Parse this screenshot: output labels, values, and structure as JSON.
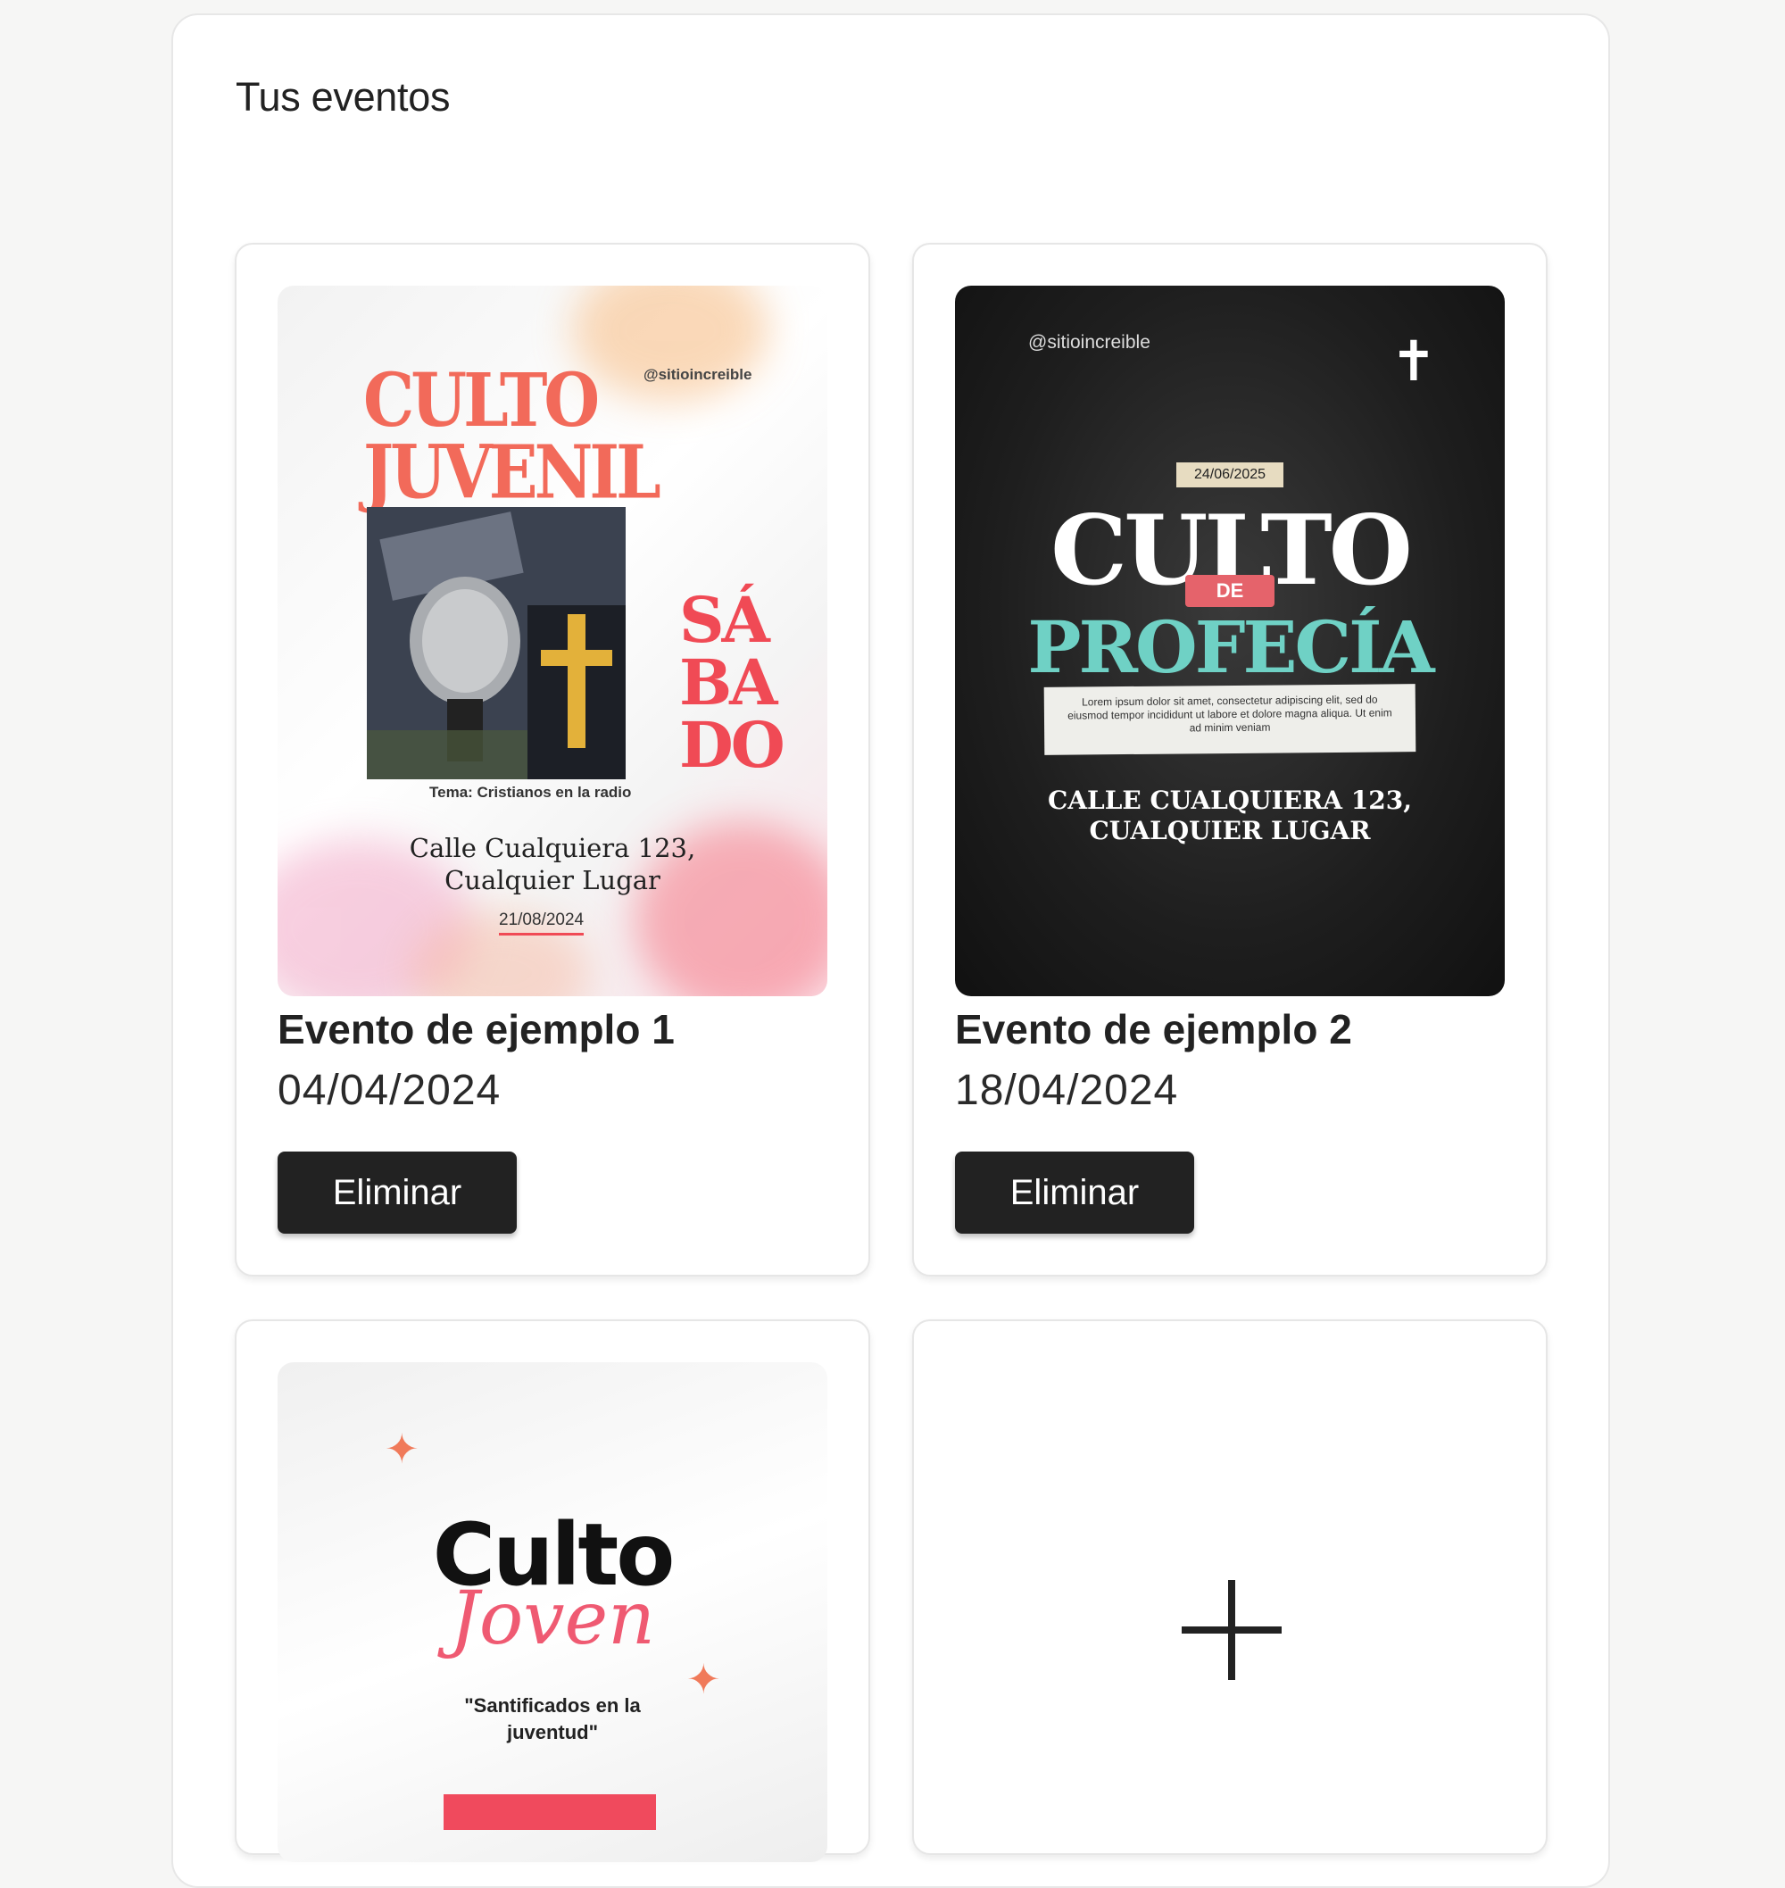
{
  "panel": {
    "title": "Tus eventos"
  },
  "events": [
    {
      "title": "Evento de ejemplo 1",
      "date": "04/04/2024",
      "delete_label": "Eliminar",
      "poster": {
        "title_line1": "CULTO",
        "title_line2": "JUVENIL",
        "handle": "@sitioincreible",
        "day_line1": "SÁ",
        "day_line2": "BA",
        "day_line3": "DO",
        "topic": "Tema: Cristianos en la radio",
        "address_line1": "Calle Cualquiera 123,",
        "address_line2": "Cualquier Lugar",
        "date": "21/08/2024"
      }
    },
    {
      "title": "Evento de ejemplo 2",
      "date": "18/04/2024",
      "delete_label": "Eliminar",
      "poster": {
        "handle": "@sitioincreible",
        "date": "24/06/2025",
        "title_line1": "CULTO",
        "connector": "DE",
        "title_line2": "PROFECÍA",
        "body": "Lorem ipsum dolor sit amet, consectetur adipiscing elit, sed do eiusmod tempor incididunt ut labore et dolore magna aliqua. Ut enim ad minim veniam",
        "address_line1": "CALLE CUALQUIERA 123,",
        "address_line2": "CUALQUIER LUGAR"
      }
    },
    {
      "poster": {
        "title_line1": "Culto",
        "title_line2": "Joven",
        "quote_line1": "\"Santificados en la",
        "quote_line2": "juventud\""
      }
    }
  ],
  "add_card": {
    "icon": "plus-icon"
  }
}
